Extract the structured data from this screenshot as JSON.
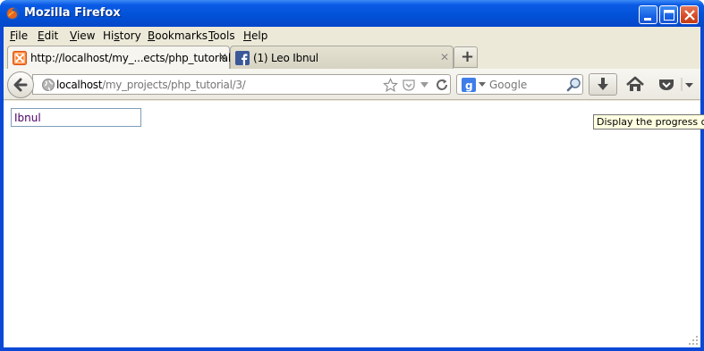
{
  "window": {
    "title": "Mozilla Firefox"
  },
  "menu": {
    "items": [
      {
        "label": "File",
        "accel": "F",
        "rest": "ile"
      },
      {
        "label": "Edit",
        "accel": "E",
        "rest": "dit"
      },
      {
        "label": "View",
        "accel": "V",
        "rest": "iew"
      },
      {
        "label": "History",
        "accel": "H",
        "pre": "Hi",
        "accel2": "s",
        "rest": "tory"
      },
      {
        "label": "Bookmarks",
        "accel": "B",
        "rest": "ookmarks"
      },
      {
        "label": "Tools",
        "accel": "T",
        "rest": "ools"
      },
      {
        "label": "Help",
        "accel": "H",
        "rest": "elp"
      }
    ]
  },
  "tabs": [
    {
      "label": "http://localhost/my_...ects/php_tutorial/3/",
      "close": "✕",
      "active": true
    },
    {
      "label": "(1) Leo Ibnul",
      "close": "✕",
      "active": false
    }
  ],
  "newtab": {
    "label": "+"
  },
  "urlbar": {
    "host": "localhost",
    "path": "/my_projects/php_tutorial/3/"
  },
  "search": {
    "placeholder": "Google"
  },
  "page": {
    "input_value": "Ibnul"
  },
  "tooltip": {
    "text": "Display the progress of o"
  },
  "colors": {
    "titlebar": "#0252d8",
    "chrome": "#ece9d8",
    "input_text": "#4b0066"
  }
}
